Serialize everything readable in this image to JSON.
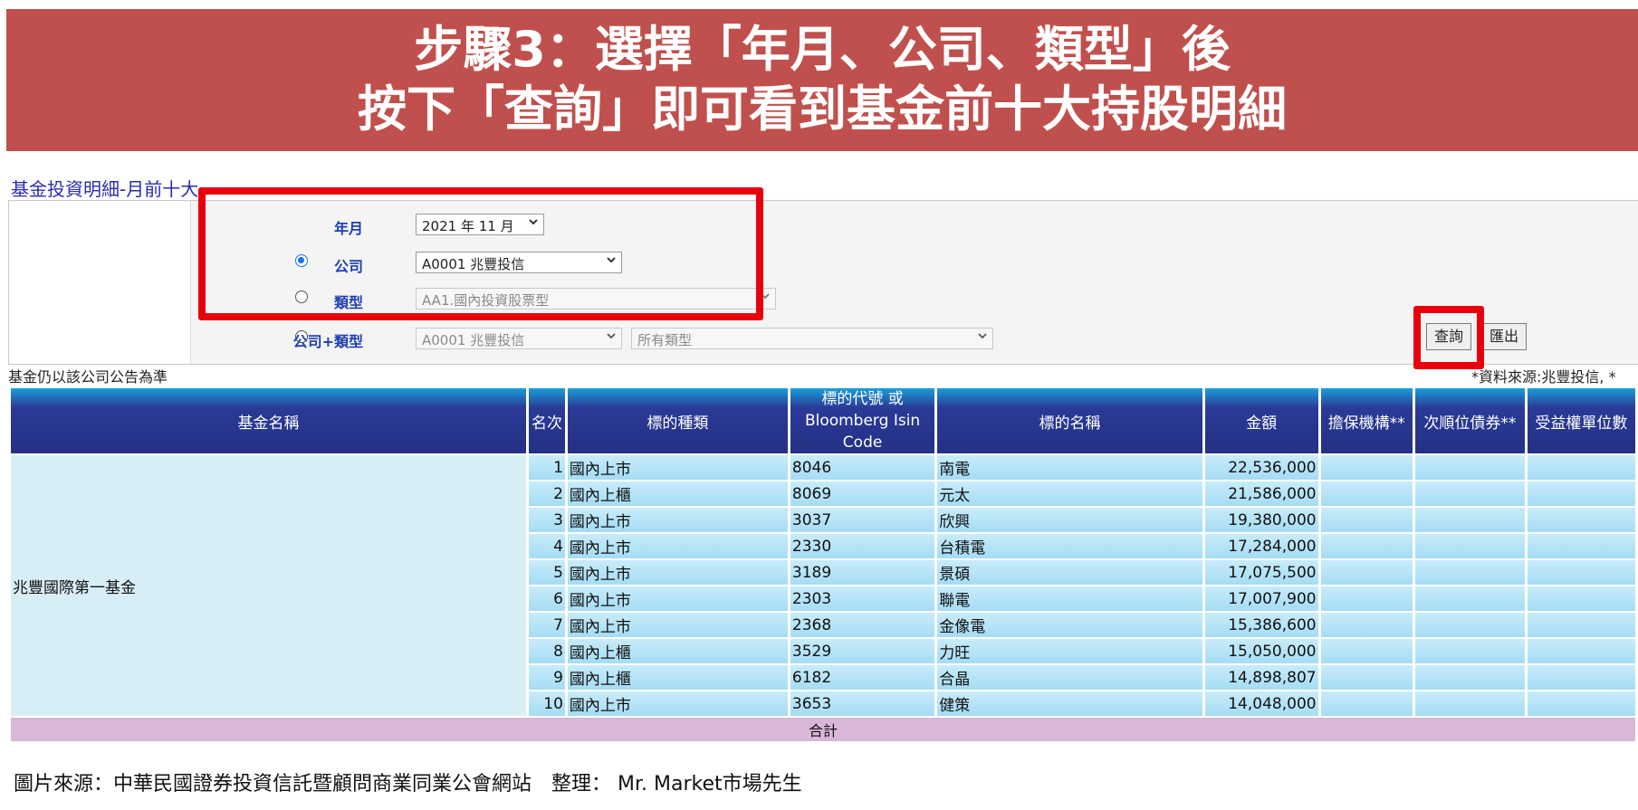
{
  "banner": {
    "line1": "步驟3：選擇「年月、公司、類型」後",
    "line2": "按下「查詢」即可看到基金前十大持股明細"
  },
  "page_heading": "基金投資明細-月前十大",
  "form": {
    "year_month_label": "年月",
    "year_month_value": "2021 年 11 月",
    "company_label": "公司",
    "company_value": "A0001 兆豐投信",
    "type_label": "類型",
    "type_value": "AA1.國內投資股票型",
    "company_type_label": "公司+類型",
    "company_type_company": "A0001 兆豐投信",
    "company_type_type": "所有類型",
    "query_button": "查詢",
    "export_button": "匯出"
  },
  "notes": {
    "left": "基金仍以該公司公告為準",
    "right": "*資料來源:兆豐投信, *"
  },
  "table": {
    "headers": [
      "基金名稱",
      "名次",
      "標的種類",
      "標的代號 或 Bloomberg Isin Code",
      "標的名稱",
      "金額",
      "擔保機構**",
      "次順位債券**",
      "受益權單位數"
    ],
    "fund_name": "兆豐國際第一基金",
    "rows": [
      {
        "rank": "1",
        "kind": "國內上市",
        "code": "8046",
        "name": "南電",
        "amount": "22,536,000"
      },
      {
        "rank": "2",
        "kind": "國內上櫃",
        "code": "8069",
        "name": "元太",
        "amount": "21,586,000"
      },
      {
        "rank": "3",
        "kind": "國內上市",
        "code": "3037",
        "name": "欣興",
        "amount": "19,380,000"
      },
      {
        "rank": "4",
        "kind": "國內上市",
        "code": "2330",
        "name": "台積電",
        "amount": "17,284,000"
      },
      {
        "rank": "5",
        "kind": "國內上市",
        "code": "3189",
        "name": "景碩",
        "amount": "17,075,500"
      },
      {
        "rank": "6",
        "kind": "國內上市",
        "code": "2303",
        "name": "聯電",
        "amount": "17,007,900"
      },
      {
        "rank": "7",
        "kind": "國內上市",
        "code": "2368",
        "name": "金像電",
        "amount": "15,386,600"
      },
      {
        "rank": "8",
        "kind": "國內上櫃",
        "code": "3529",
        "name": "力旺",
        "amount": "15,050,000"
      },
      {
        "rank": "9",
        "kind": "國內上櫃",
        "code": "6182",
        "name": "合晶",
        "amount": "14,898,807"
      },
      {
        "rank": "10",
        "kind": "國內上市",
        "code": "3653",
        "name": "健策",
        "amount": "14,048,000"
      }
    ],
    "total_label": "合計"
  },
  "footer": "圖片來源：中華民國證券投資信託暨顧問商業同業公會網站　整理：  Mr. Market市場先生",
  "colors": {
    "banner": "#c0504d",
    "highlight": "#e8000d",
    "header": "#253085",
    "row": "#a5dcf4",
    "total": "#d8b7d8"
  }
}
